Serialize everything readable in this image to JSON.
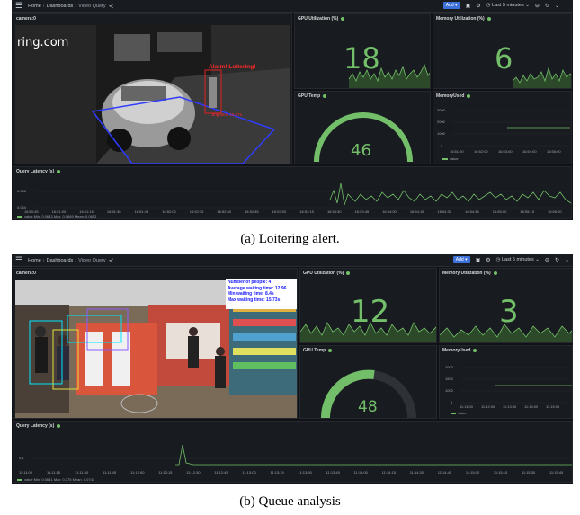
{
  "dashboards": [
    {
      "breadcrumb": {
        "home": "Home",
        "dashboards": "Dashboards",
        "page": "Video Query"
      },
      "toolbar": {
        "add_label": "Add",
        "time_range": "Last 5 minutes"
      },
      "video": {
        "title": "camera:0",
        "watermark": "ring.com",
        "alert_text": "Alarm! Loitering!",
        "timer_text": "...ring time: 15.37s"
      },
      "gpu_util": {
        "title": "GPU Utilization (%)",
        "value": "18"
      },
      "mem_util": {
        "title": "Memory Utilization (%)",
        "value": "6"
      },
      "gpu_temp": {
        "title": "GPU Temp",
        "value": "46",
        "gauge_fraction": 0.46
      },
      "mem_used": {
        "title": "MemoryUsed",
        "y_ticks": [
          "3000",
          "2000",
          "1000",
          "0"
        ],
        "x_ticks": [
          "16:51:00",
          "16:52:00",
          "16:53:00",
          "16:54:00",
          "16:55:00"
        ],
        "legend": "value"
      },
      "latency": {
        "title": "Query Latency (s)",
        "y_ticks": [
          "0.066",
          "0.064"
        ],
        "x_ticks": [
          "16:50:45",
          "16:51:00",
          "16:51:15",
          "16:51:30",
          "16:51:45",
          "16:52:00",
          "16:52:15",
          "16:52:30",
          "16:52:45",
          "16:53:00",
          "16:53:15",
          "16:53:30",
          "16:53:45",
          "16:54:00",
          "16:54:15",
          "16:54:30",
          "16:54:45",
          "16:55:00",
          "16:55:15",
          "16:55:00"
        ],
        "legend": "value  Min: 0.0643  Max: 0.0669  Mean: 0.0652"
      }
    },
    {
      "breadcrumb": {
        "home": "Home",
        "dashboards": "Dashboards",
        "page": "Video Query"
      },
      "toolbar": {
        "add_label": "Add",
        "time_range": "Last 5 minutes"
      },
      "video": {
        "title": "camera:0",
        "stats": [
          "Number of people: 4",
          "Average waiting time: 12.96",
          "Min waiting time: 8.4s",
          "Max waiting time: 15.73s"
        ]
      },
      "gpu_util": {
        "title": "GPU Utilization (%)",
        "value": "12"
      },
      "mem_util": {
        "title": "Memory Utilization (%)",
        "value": "3"
      },
      "gpu_temp": {
        "title": "GPU Temp",
        "value": "48",
        "gauge_fraction": 0.48
      },
      "mem_used": {
        "title": "MemoryUsed",
        "y_ticks": [
          "2000",
          "1500",
          "1000",
          "0"
        ],
        "x_ticks": [
          "11:11:00",
          "11:12:00",
          "11:13:00",
          "11:14:00",
          "11:15:00"
        ],
        "legend": "value"
      },
      "latency": {
        "title": "Query Latency (s)",
        "y_ticks": [
          "0.1"
        ],
        "x_ticks": [
          "11:11:00",
          "11:11:15",
          "11:11:30",
          "11:11:45",
          "11:12:00",
          "11:12:15",
          "11:12:30",
          "11:12:45",
          "11:13:00",
          "11:13:15",
          "11:13:30",
          "11:13:45",
          "11:14:00",
          "11:14:15",
          "11:14:30",
          "11:14:45",
          "11:15:00",
          "11:15:15",
          "11:15:30",
          "11:15:45"
        ],
        "legend": "value  Min: 0.0641  Max: 0.375  Mean: 0.0741"
      }
    }
  ],
  "captions": [
    "(a) Loitering alert.",
    "(b) Queue analysis"
  ],
  "colors": {
    "green": "#73bf69",
    "panel": "#181b1f",
    "background": "#111217",
    "accent": "#3d71d9"
  }
}
